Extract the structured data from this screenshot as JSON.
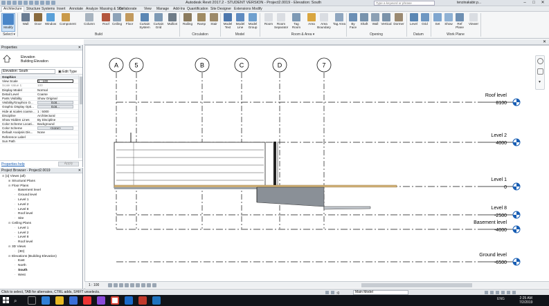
{
  "window": {
    "title": "Autodesk Revit 2017.2 - STUDENT VERSION -   Project2.0019 - Elevation: South",
    "search_placeholder": "Type a keyword or phrase",
    "user": "tenzinakabir.p..."
  },
  "ribbon_tabs": [
    "Architecture",
    "Structure",
    "Systems",
    "Insert",
    "Annotate",
    "Analyze",
    "Massing & Site",
    "Collaborate",
    "View",
    "Manage",
    "Add-Ins",
    "Quantification",
    "Site Designer",
    "Extensions",
    "Modify"
  ],
  "ribbon": {
    "modify": "Modify",
    "select": "Select ▾",
    "build": [
      "Wall",
      "Door",
      "Window",
      "Component",
      "Column",
      "Roof",
      "Ceiling",
      "Floor",
      "Curtain System",
      "Curtain Grid",
      "Mullion"
    ],
    "circulation": [
      "Railing",
      "Ramp",
      "Stair"
    ],
    "model": [
      "Model Text",
      "Model Line",
      "Model Group"
    ],
    "room_area": [
      "Room",
      "Room Separator",
      "Tag Room",
      "Area",
      "Area Boundary",
      "Tag Area"
    ],
    "opening": [
      "By Face",
      "Shaft",
      "Wall",
      "Vertical",
      "Dormer"
    ],
    "datum": [
      "Level",
      "Grid"
    ],
    "work_plane": [
      "Set",
      "Show",
      "Ref Plane",
      "Viewer"
    ],
    "groups": [
      "Build",
      "Circulation",
      "Model",
      "Room & Area ▾",
      "Opening",
      "Datum",
      "Work Plane"
    ]
  },
  "properties": {
    "title": "Properties",
    "type_family": "Elevation",
    "type_name": "Building Elevation",
    "instance": "Elevation: South",
    "edit_type": "Edit Type",
    "rows": [
      {
        "k": "Graphics",
        "v": "",
        "cat": true
      },
      {
        "k": "View Scale",
        "v": "1 : 100",
        "style": "boxed"
      },
      {
        "k": "Scale Value    1:",
        "v": "100",
        "style": "dim"
      },
      {
        "k": "Display Model",
        "v": "Normal"
      },
      {
        "k": "Detail Level",
        "v": "Coarse"
      },
      {
        "k": "Parts Visibility",
        "v": "Show Original"
      },
      {
        "k": "Visibility/Graphics O...",
        "v": "Edit...",
        "style": "btn"
      },
      {
        "k": "Graphic Display Opti...",
        "v": "Edit...",
        "style": "btn"
      },
      {
        "k": "Hide at scales coarse...",
        "v": "1 : 5000"
      },
      {
        "k": "Discipline",
        "v": "Architectural"
      },
      {
        "k": "Show Hidden Lines",
        "v": "By Discipline"
      },
      {
        "k": "Color Scheme Locati...",
        "v": "Background"
      },
      {
        "k": "Color Scheme",
        "v": "<none>",
        "style": "btn"
      },
      {
        "k": "Default Analysis Dis...",
        "v": "None"
      },
      {
        "k": "Reference Label",
        "v": ""
      },
      {
        "k": "Sun Path",
        "v": ""
      }
    ],
    "help": "Properties help",
    "apply": "Apply"
  },
  "browser": {
    "title": "Project Browser - Project2.0019",
    "nodes": [
      {
        "t": "[o] Views (all)",
        "d": 0,
        "g": "⊟"
      },
      {
        "t": "Structural Plans",
        "d": 1,
        "g": "⊞"
      },
      {
        "t": "Floor Plans",
        "d": 1,
        "g": "⊟"
      },
      {
        "t": "Basement level",
        "d": 2,
        "g": ""
      },
      {
        "t": "Ground level",
        "d": 2,
        "g": ""
      },
      {
        "t": "Level 1",
        "d": 2,
        "g": ""
      },
      {
        "t": "Level 2",
        "d": 2,
        "g": ""
      },
      {
        "t": "Level 8",
        "d": 2,
        "g": ""
      },
      {
        "t": "Roof level",
        "d": 2,
        "g": ""
      },
      {
        "t": "Site",
        "d": 2,
        "g": ""
      },
      {
        "t": "Ceiling Plans",
        "d": 1,
        "g": "⊟"
      },
      {
        "t": "Level 1",
        "d": 2,
        "g": ""
      },
      {
        "t": "Level 2",
        "d": 2,
        "g": ""
      },
      {
        "t": "Level 8",
        "d": 2,
        "g": ""
      },
      {
        "t": "Roof level",
        "d": 2,
        "g": ""
      },
      {
        "t": "3D Views",
        "d": 1,
        "g": "⊟"
      },
      {
        "t": "{3D}",
        "d": 2,
        "g": ""
      },
      {
        "t": "Elevations (Building Elevation)",
        "d": 1,
        "g": "⊟"
      },
      {
        "t": "East",
        "d": 2,
        "g": ""
      },
      {
        "t": "North",
        "d": 2,
        "g": ""
      },
      {
        "t": "South",
        "d": 2,
        "g": "",
        "bold": true
      },
      {
        "t": "West",
        "d": 2,
        "g": ""
      }
    ]
  },
  "grids": [
    "A",
    "5",
    "B",
    "C",
    "D",
    "7"
  ],
  "levels": [
    {
      "name": "Roof level",
      "value": "8100"
    },
    {
      "name": "Level 2",
      "value": "4000"
    },
    {
      "name": "Level 1",
      "value": "0"
    },
    {
      "name": "Level 8",
      "value": "-2500"
    },
    {
      "name": "Basement level",
      "value": "-4000"
    },
    {
      "name": "Ground level",
      "value": "-6500"
    }
  ],
  "view_bar": {
    "scale": "1 : 100"
  },
  "status": {
    "message": "Click to select, TAB for alternates, CTRL adds, SHIFT unselects.",
    "model": "Main Model",
    "zero": ":0"
  },
  "taskbar": {
    "lang": "ENG",
    "time": "2:25 AM",
    "date": "7/2/2019"
  }
}
